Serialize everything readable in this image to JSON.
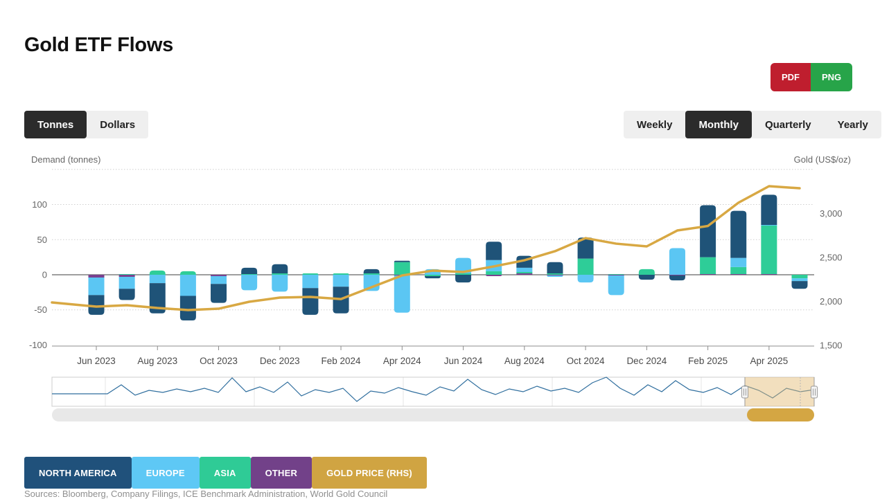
{
  "header": {
    "title": "Gold ETF Flows"
  },
  "export_buttons": {
    "pdf_label": "PDF",
    "png_label": "PNG"
  },
  "unit_toggle": {
    "options": [
      {
        "label": "Tonnes",
        "active": true
      },
      {
        "label": "Dollars",
        "active": false
      }
    ]
  },
  "period_toggle": {
    "options": [
      {
        "label": "Weekly",
        "active": false
      },
      {
        "label": "Monthly",
        "active": true
      },
      {
        "label": "Quarterly",
        "active": false
      },
      {
        "label": "Yearly",
        "active": false
      }
    ]
  },
  "legend": [
    {
      "label": "NORTH AMERICA",
      "color": "#20517b"
    },
    {
      "label": "EUROPE",
      "color": "#5ec8f5"
    },
    {
      "label": "ASIA",
      "color": "#2fcb96"
    },
    {
      "label": "OTHER",
      "color": "#724189"
    },
    {
      "label": "GOLD PRICE (RHS)",
      "color": "#d0a442"
    }
  ],
  "source_note": "Sources: Bloomberg, Company Filings, ICE Benchmark Administration, World Gold Council",
  "chart_data": {
    "type": "bar",
    "subtype": "stacked-column-with-line",
    "title": "Gold ETF Flows",
    "categories": [
      "Jun 2023",
      "Jul 2023",
      "Aug 2023",
      "Sep 2023",
      "Oct 2023",
      "Nov 2023",
      "Dec 2023",
      "Jan 2024",
      "Feb 2024",
      "Mar 2024",
      "Apr 2024",
      "May 2024",
      "Jun 2024",
      "Jul 2024",
      "Aug 2024",
      "Sep 2024",
      "Oct 2024",
      "Nov 2024",
      "Dec 2024",
      "Jan 2025",
      "Feb 2025",
      "Mar 2025",
      "Apr 2025",
      "May 2025"
    ],
    "x_tick_labels": [
      "Jun 2023",
      "Aug 2023",
      "Oct 2023",
      "Dec 2023",
      "Feb 2024",
      "Apr 2024",
      "Jun 2024",
      "Aug 2024",
      "Oct 2024",
      "Dec 2024",
      "Feb 2025",
      "Apr 2025"
    ],
    "series": [
      {
        "name": "North America",
        "color": "#1f5378",
        "values": [
          -28,
          -16,
          -43,
          -35,
          -27,
          9,
          13,
          -38,
          -38,
          6,
          2,
          -3,
          -11,
          26,
          17,
          16,
          30,
          0,
          -7,
          -7,
          74,
          67,
          43,
          -11
        ]
      },
      {
        "name": "Europe",
        "color": "#5bc6f3",
        "values": [
          -25,
          -17,
          -12,
          -30,
          -11,
          -22,
          -24,
          -19,
          -17,
          -23,
          -53,
          8,
          22,
          16,
          6,
          -2,
          -11,
          -28,
          0,
          38,
          0,
          13,
          1,
          -4
        ]
      },
      {
        "name": "Asia",
        "color": "#2ecd98",
        "values": [
          0,
          1,
          6,
          5,
          0,
          1,
          2,
          2,
          2,
          2,
          18,
          -2,
          2,
          5,
          2,
          2,
          23,
          1,
          8,
          0,
          24,
          10,
          69,
          -5
        ]
      },
      {
        "name": "Other",
        "color": "#79418f",
        "values": [
          -4,
          -3,
          0,
          0,
          -2,
          0,
          0,
          0,
          0,
          0,
          -1,
          0,
          0,
          -2,
          2,
          -1,
          0,
          -1,
          0,
          -1,
          1,
          1,
          1,
          0
        ]
      }
    ],
    "line_series": {
      "name": "Gold Price (RHS)",
      "color": "#d8a843",
      "axis": "right",
      "lead_in_value": 1988,
      "values": [
        1941,
        1957,
        1925,
        1902,
        1917,
        1996,
        2043,
        2051,
        2027,
        2161,
        2295,
        2350,
        2335,
        2398,
        2468,
        2571,
        2720,
        2657,
        2626,
        2807,
        2858,
        3123,
        3311,
        3287
      ]
    },
    "yaxis_left": {
      "title": "Demand (tonnes)",
      "tick_labels": [
        100,
        50,
        0,
        -50,
        -100
      ],
      "gridlines": [
        150,
        100,
        50,
        -50
      ],
      "range": [
        -100,
        150
      ],
      "grid": "dotted"
    },
    "yaxis_right": {
      "title": "Gold (US$/oz)",
      "tick_labels": [
        "3,000",
        "2,500",
        "2,000",
        "1,500"
      ],
      "tick_values": [
        3000,
        2500,
        2000,
        1500
      ],
      "range": [
        1500,
        3520
      ]
    },
    "legend_position": "bottom-left"
  },
  "navigator": {
    "sparkline_y": [
      569,
      569,
      569,
      569,
      569,
      556,
      571,
      564,
      567,
      562,
      566,
      561,
      567,
      546,
      566,
      559,
      567,
      552,
      572,
      563,
      567,
      561,
      580,
      565,
      568,
      560,
      566,
      571,
      559,
      565,
      548,
      563,
      570,
      562,
      566,
      558,
      565,
      561,
      567,
      553,
      545,
      561,
      571,
      556,
      566,
      550,
      563,
      567,
      560,
      570,
      557,
      564,
      575,
      561,
      566,
      563
    ],
    "selection_color": "#e2b96e",
    "line_color": "#2f6e9e",
    "scrollbar_thumb_color": "#d4a643"
  }
}
